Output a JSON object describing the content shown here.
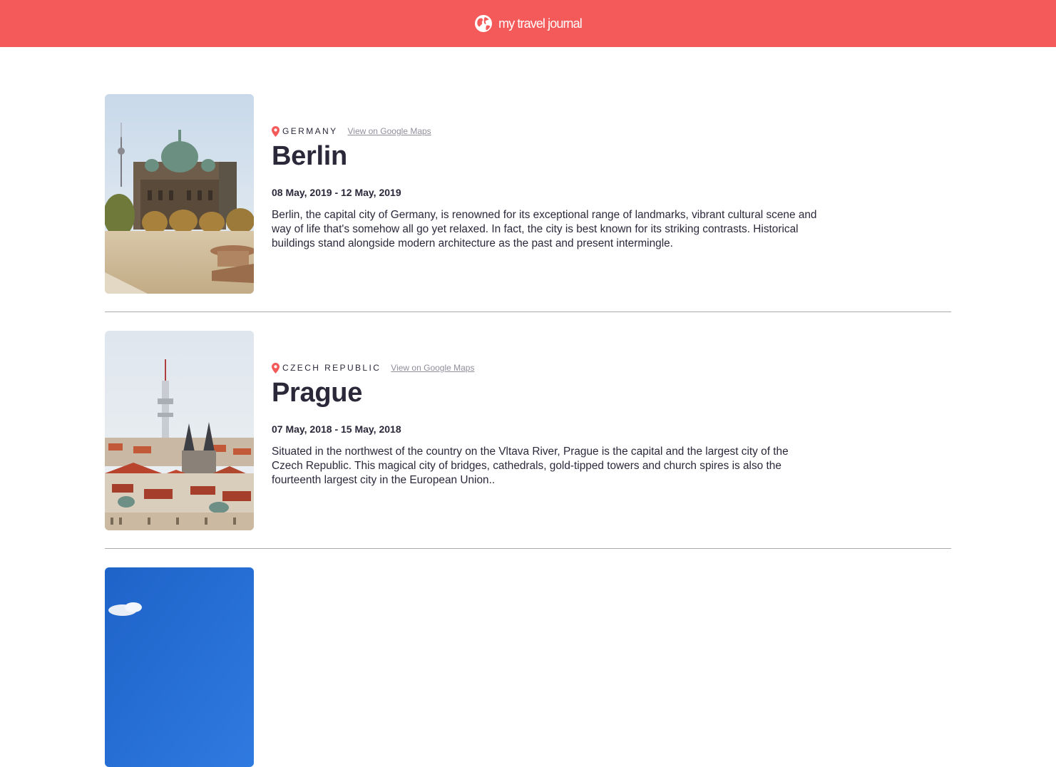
{
  "header": {
    "title": "my travel journal",
    "icon": "globe-icon",
    "bg_color": "#f55a5a"
  },
  "entries": [
    {
      "image": "berlin-cathedral-photo",
      "country": "GERMANY",
      "maps_link": "View on Google Maps",
      "city": "Berlin",
      "dates": "08 May, 2019 - 12 May, 2019",
      "description": "Berlin, the capital city of Germany, is renowned for its exceptional range of landmarks, vibrant cultural scene and way of life that's somehow all go yet relaxed. In fact, the city is best known for its striking contrasts. Historical buildings stand alongside modern architecture as the past and present intermingle."
    },
    {
      "image": "prague-city-photo",
      "country": "CZECH REPUBLIC",
      "maps_link": "View on Google Maps",
      "city": "Prague",
      "dates": "07 May, 2018 - 15 May, 2018",
      "description": "Situated in the northwest of the country on the Vltava River, Prague is the capital and the largest city of the Czech Republic. This magical city of bridges, cathedrals, gold-tipped towers and church spires is also the fourteenth largest city in the European Union.."
    },
    {
      "image": "blue-sky-photo"
    }
  ],
  "colors": {
    "accent": "#f55a5a",
    "text": "#2b283a",
    "link": "#918e9b"
  }
}
